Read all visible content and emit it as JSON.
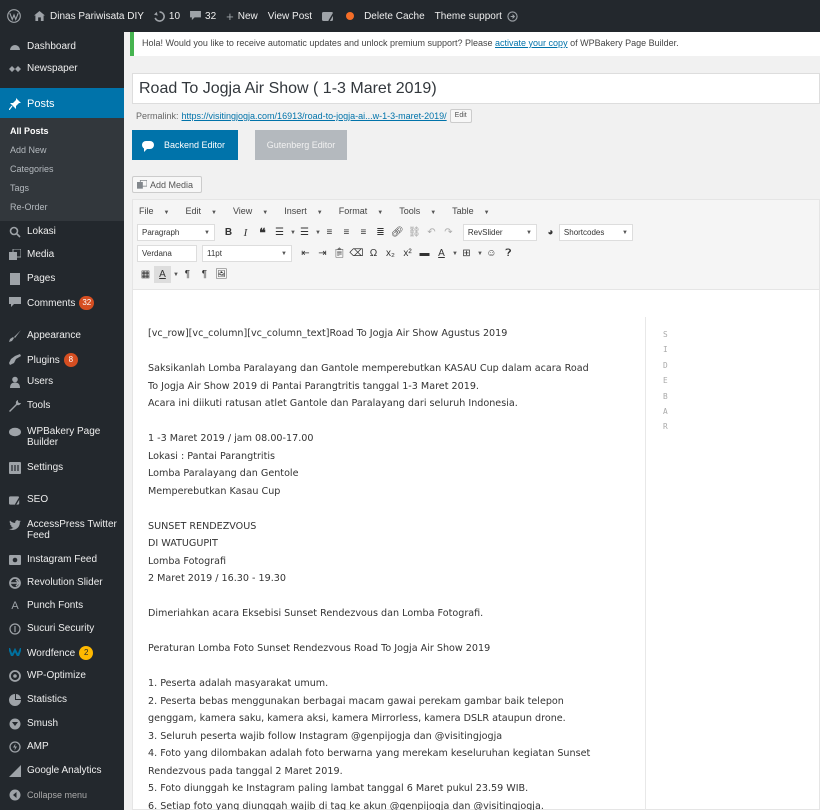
{
  "colors": {
    "admin_bar": "#23282d",
    "sidebar": "#23282d",
    "accent": "#0073aa",
    "badge": "#d54e21",
    "notice_border": "#46b450"
  },
  "admin_bar": {
    "site_name": "Dinas Pariwisata DIY",
    "updates_count": "10",
    "comments_count": "32",
    "new_label": "New",
    "view_post_label": "View Post",
    "delete_cache_label": "Delete Cache",
    "theme_support_label": "Theme support"
  },
  "sidebar": {
    "items": [
      {
        "label": "Dashboard",
        "icon": "dashboard-icon"
      },
      {
        "label": "Newspaper",
        "icon": "newspaper-icon"
      },
      {
        "label": "Posts",
        "icon": "pin-icon"
      },
      {
        "label": "Lokasi",
        "icon": "location-icon"
      },
      {
        "label": "Media",
        "icon": "media-icon"
      },
      {
        "label": "Pages",
        "icon": "page-icon"
      },
      {
        "label": "Comments",
        "icon": "comment-icon",
        "badge": "32"
      },
      {
        "label": "Appearance",
        "icon": "brush-icon"
      },
      {
        "label": "Plugins",
        "icon": "plugin-icon",
        "badge": "8"
      },
      {
        "label": "Users",
        "icon": "users-icon"
      },
      {
        "label": "Tools",
        "icon": "wrench-icon"
      },
      {
        "label": "WPBakery Page Builder",
        "icon": "wpbakery-icon"
      },
      {
        "label": "Settings",
        "icon": "settings-icon"
      },
      {
        "label": "SEO",
        "icon": "seo-icon"
      },
      {
        "label": "AccessPress Twitter Feed",
        "icon": "twitter-icon"
      },
      {
        "label": "Instagram Feed",
        "icon": "instagram-icon"
      },
      {
        "label": "Revolution Slider",
        "icon": "slider-icon"
      },
      {
        "label": "Punch Fonts",
        "icon": "font-icon"
      },
      {
        "label": "Sucuri Security",
        "icon": "sucuri-icon"
      },
      {
        "label": "Wordfence",
        "icon": "wordfence-icon",
        "badge": "2"
      },
      {
        "label": "WP-Optimize",
        "icon": "optimize-icon"
      },
      {
        "label": "Statistics",
        "icon": "pie-chart-icon"
      },
      {
        "label": "Smush",
        "icon": "smush-icon"
      },
      {
        "label": "AMP",
        "icon": "amp-icon"
      },
      {
        "label": "Google Analytics",
        "icon": "analytics-icon"
      }
    ],
    "posts_submenu": [
      "All Posts",
      "Add New",
      "Categories",
      "Tags",
      "Re-Order"
    ],
    "collapse_label": "Collapse menu"
  },
  "notice": {
    "text_before": "Hola! Would you like to receive automatic updates and unlock premium support? Please ",
    "link_text": "activate your copy",
    "text_after": " of WPBakery Page Builder."
  },
  "post": {
    "title": "Road To Jogja Air Show ( 1-3 Maret 2019)",
    "permalink_label": "Permalink:",
    "permalink_url": "https://visitingjogja.com/16913/road-to-jogja-ai...w-1-3-maret-2019/",
    "edit_label": "Edit"
  },
  "buttons": {
    "backend_editor": "Backend Editor",
    "gutenberg_editor": "Gutenberg Editor",
    "add_media": "Add Media"
  },
  "editor": {
    "menubar": [
      "File",
      "Edit",
      "View",
      "Insert",
      "Format",
      "Tools",
      "Table"
    ],
    "format_select": "Paragraph",
    "revslider_select": "RevSlider",
    "shortcodes_select": "Shortcodes",
    "font_family_select": "Verdana",
    "font_size_select": "11pt",
    "sidebar_letters": [
      "S",
      "I",
      "D",
      "E",
      "B",
      "A",
      "R"
    ],
    "content_lines": [
      "[vc_row][vc_column][vc_column_text]Road To Jogja Air Show Agustus 2019",
      "",
      "Saksikanlah Lomba Paralayang dan Gantole memperebutkan KASAU Cup dalam acara Road",
      "To Jogja Air Show 2019 di Pantai Parangtritis tanggal 1-3 Maret 2019.",
      "Acara ini diikuti ratusan atlet Gantole dan Paralayang dari seluruh Indonesia.",
      "",
      "1 -3 Maret 2019 / jam 08.00-17.00",
      "Lokasi : Pantai Parangtritis",
      "Lomba Paralayang dan Gentole",
      "Memperebutkan Kasau Cup",
      "",
      "SUNSET RENDEZVOUS",
      "DI WATUGUPIT",
      "Lomba Fotografi",
      "2 Maret 2019 / 16.30 - 19.30",
      "",
      "Dimeriahkan acara Eksebisi Sunset Rendezvous dan Lomba Fotografi.",
      "",
      "Peraturan Lomba Foto Sunset Rendezvous Road To Jogja Air Show 2019",
      "",
      "1. Peserta adalah masyarakat umum.",
      "2. Peserta bebas menggunakan berbagai macam gawai perekam gambar baik telepon",
      "genggam, kamera saku, kamera aksi, kamera Mirrorless, kamera DSLR ataupun drone.",
      "3. Seluruh peserta wajib follow Instagram @genpijogja dan @visitingjogja",
      "4. Foto yang dilombakan adalah foto berwarna yang merekam keseluruhan kegiatan Sunset",
      "Rendezvous pada tanggal 2 Maret 2019.",
      "5. Foto diunggah ke Instagram paling lambat tanggal 6 Maret pukul 23.59 WIB.",
      "6. Setiap foto yang diunggah wajib di tag ke akun @genpijogja dan @visitingjogja."
    ]
  }
}
